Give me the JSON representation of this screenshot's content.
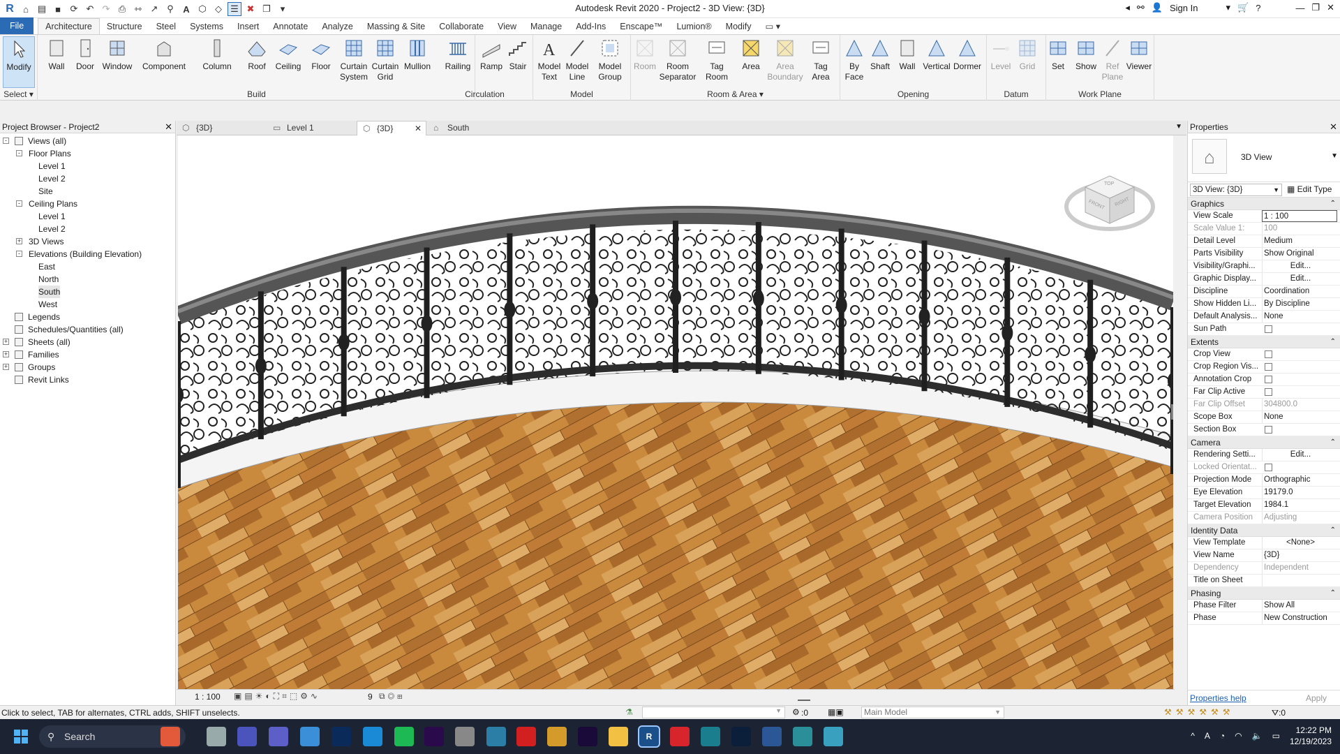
{
  "app": {
    "title": "Autodesk Revit 2020 - Project2 - 3D View: {3D}",
    "sign_in": "Sign In"
  },
  "menu_tabs": [
    "File",
    "Architecture",
    "Structure",
    "Steel",
    "Systems",
    "Insert",
    "Annotate",
    "Analyze",
    "Massing & Site",
    "Collaborate",
    "View",
    "Manage",
    "Add-Ins",
    "Enscape™",
    "Lumion®",
    "Modify"
  ],
  "ribbon": {
    "select_label": "Select",
    "modify": "Modify",
    "groups": {
      "build": "Build",
      "circulation": "Circulation",
      "model": "Model",
      "room_area": "Room & Area",
      "opening": "Opening",
      "datum": "Datum",
      "work_plane": "Work Plane"
    },
    "buttons": {
      "wall": "Wall",
      "door": "Door",
      "window": "Window",
      "component": "Component",
      "column": "Column",
      "roof": "Roof",
      "ceiling": "Ceiling",
      "floor": "Floor",
      "curtain_system": "Curtain\nSystem",
      "curtain_grid": "Curtain\nGrid",
      "mullion": "Mullion",
      "railing": "Railing",
      "ramp": "Ramp",
      "stair": "Stair",
      "model_text": "Model\nText",
      "model_line": "Model\nLine",
      "model_group": "Model\nGroup",
      "room": "Room",
      "room_separator": "Room\nSeparator",
      "tag_room": "Tag\nRoom",
      "area": "Area",
      "area_boundary": "Area\nBoundary",
      "tag_area": "Tag\nArea",
      "by_face": "By\nFace",
      "shaft": "Shaft",
      "wall_open": "Wall",
      "vertical": "Vertical",
      "dormer": "Dormer",
      "level": "Level",
      "grid": "Grid",
      "set": "Set",
      "show": "Show",
      "ref_plane": "Ref\nPlane",
      "viewer": "Viewer"
    }
  },
  "project_browser": {
    "title": "Project Browser - Project2",
    "items": [
      {
        "label": "Views (all)",
        "level": 0,
        "exp": "-"
      },
      {
        "label": "Floor Plans",
        "level": 1,
        "exp": "-"
      },
      {
        "label": "Level 1",
        "level": 2
      },
      {
        "label": "Level 2",
        "level": 2
      },
      {
        "label": "Site",
        "level": 2
      },
      {
        "label": "Ceiling Plans",
        "level": 1,
        "exp": "-"
      },
      {
        "label": "Level 1",
        "level": 2
      },
      {
        "label": "Level 2",
        "level": 2
      },
      {
        "label": "3D Views",
        "level": 1,
        "exp": "+"
      },
      {
        "label": "Elevations (Building Elevation)",
        "level": 1,
        "exp": "-"
      },
      {
        "label": "East",
        "level": 2
      },
      {
        "label": "North",
        "level": 2
      },
      {
        "label": "South",
        "level": 2,
        "selected": true
      },
      {
        "label": "West",
        "level": 2
      },
      {
        "label": "Legends",
        "level": 0
      },
      {
        "label": "Schedules/Quantities (all)",
        "level": 0
      },
      {
        "label": "Sheets (all)",
        "level": 0,
        "exp": "+"
      },
      {
        "label": "Families",
        "level": 0,
        "exp": "+"
      },
      {
        "label": "Groups",
        "level": 0,
        "exp": "+"
      },
      {
        "label": "Revit Links",
        "level": 0
      }
    ]
  },
  "view_tabs": [
    {
      "label": "{3D}"
    },
    {
      "label": "Level 1"
    },
    {
      "label": "{3D}",
      "active": true
    },
    {
      "label": "South"
    }
  ],
  "viewcube": {
    "top": "TOP",
    "front": "FRONT",
    "right": "RIGHT"
  },
  "view_scale_bar": "1 : 100",
  "view_bar_num": "9",
  "properties": {
    "title": "Properties",
    "type_name": "3D View",
    "instance_select": "3D View: {3D}",
    "edit_type": "Edit Type",
    "help": "Properties help",
    "apply": "Apply",
    "sections": [
      {
        "name": "Graphics",
        "rows": [
          {
            "k": "View Scale",
            "v": "1 : 100",
            "box": true
          },
          {
            "k": "Scale Value    1:",
            "v": "100",
            "dim": true
          },
          {
            "k": "Detail Level",
            "v": "Medium"
          },
          {
            "k": "Parts Visibility",
            "v": "Show Original"
          },
          {
            "k": "Visibility/Graphi...",
            "v": "Edit...",
            "center": true
          },
          {
            "k": "Graphic Display...",
            "v": "Edit...",
            "center": true
          },
          {
            "k": "Discipline",
            "v": "Coordination"
          },
          {
            "k": "Show Hidden Li...",
            "v": "By Discipline"
          },
          {
            "k": "Default Analysis...",
            "v": "None"
          },
          {
            "k": "Sun Path",
            "cb": true
          }
        ]
      },
      {
        "name": "Extents",
        "rows": [
          {
            "k": "Crop View",
            "cb": true
          },
          {
            "k": "Crop Region Vis...",
            "cb": true
          },
          {
            "k": "Annotation Crop",
            "cb": true
          },
          {
            "k": "Far Clip Active",
            "cb": true
          },
          {
            "k": "Far Clip Offset",
            "v": "304800.0",
            "dim": true
          },
          {
            "k": "Scope Box",
            "v": "None"
          },
          {
            "k": "Section Box",
            "cb": true
          }
        ]
      },
      {
        "name": "Camera",
        "rows": [
          {
            "k": "Rendering Setti...",
            "v": "Edit...",
            "center": true
          },
          {
            "k": "Locked Orientat...",
            "cb": true,
            "dim": true
          },
          {
            "k": "Projection Mode",
            "v": "Orthographic"
          },
          {
            "k": "Eye Elevation",
            "v": "19179.0"
          },
          {
            "k": "Target Elevation",
            "v": "1984.1"
          },
          {
            "k": "Camera Position",
            "v": "Adjusting",
            "dim": true
          }
        ]
      },
      {
        "name": "Identity Data",
        "rows": [
          {
            "k": "View Template",
            "v": "<None>",
            "center": true
          },
          {
            "k": "View Name",
            "v": "{3D}"
          },
          {
            "k": "Dependency",
            "v": "Independent",
            "dim": true
          },
          {
            "k": "Title on Sheet",
            "v": ""
          }
        ]
      },
      {
        "name": "Phasing",
        "rows": [
          {
            "k": "Phase Filter",
            "v": "Show All"
          },
          {
            "k": "Phase",
            "v": "New Construction"
          }
        ]
      }
    ]
  },
  "status": {
    "text": "Click to select, TAB for alternates, CTRL adds, SHIFT unselects.",
    "zero": ":0",
    "model": "Main Model",
    "filter_count": ":0"
  },
  "taskbar": {
    "search": "Search",
    "time": "12:22 PM",
    "date": "12/19/2023"
  },
  "colors": {
    "accent": "#2b6bb5",
    "wood1": "#c98a3e",
    "wood2": "#a86b2a",
    "iron": "#2a2a2a",
    "taskbar": "#1c2433"
  }
}
